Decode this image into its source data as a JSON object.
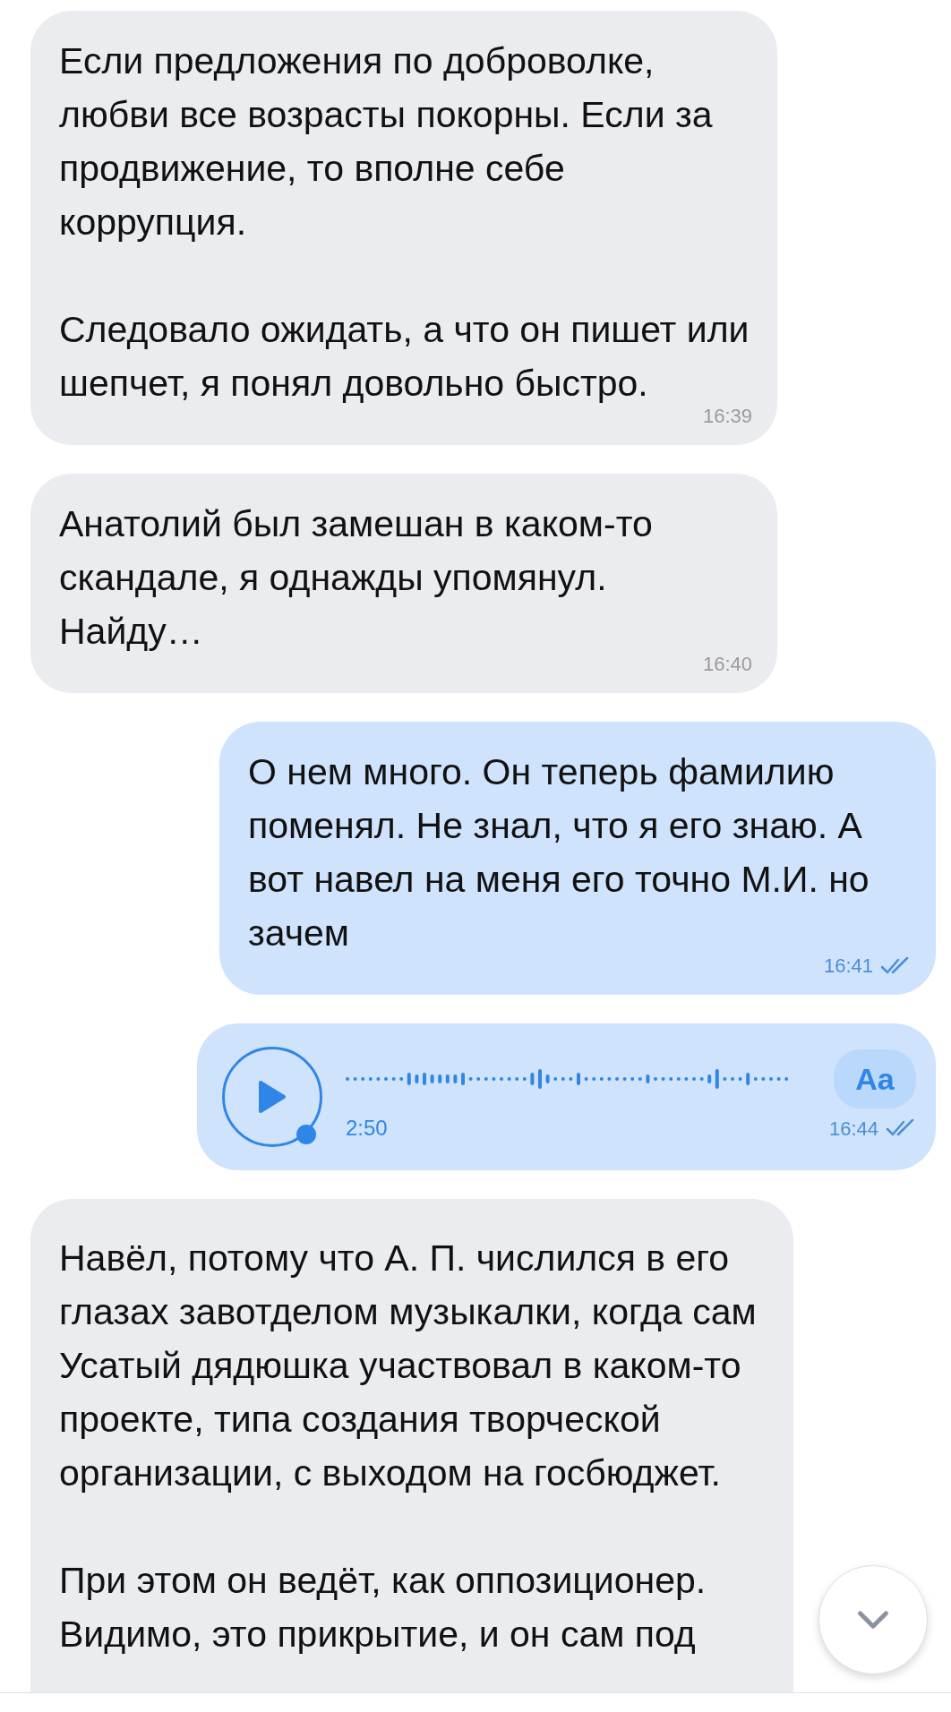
{
  "messages": [
    {
      "kind": "text",
      "outgoing": false,
      "text": "Если предложения по доброволке, любви все возрасты покорны. Если за продвижение, то вполне себе коррупция.\n\nСледовало ожидать, а что он пишет или шепчет, я понял довольно быстро.",
      "time": "16:39"
    },
    {
      "kind": "text",
      "outgoing": false,
      "text": "Анатолий был замешан в каком-то скандале, я однажды упомянул. Найду…",
      "time": "16:40"
    },
    {
      "kind": "text",
      "outgoing": true,
      "text": "О нем много. Он теперь фамилию поменял. Не знал, что я его знаю. А вот навел на меня его точно М.И. но зачем",
      "time": "16:41",
      "read": true
    },
    {
      "kind": "voice",
      "outgoing": true,
      "duration": "2:50",
      "transcribe_label": "Aa",
      "time": "16:44",
      "read": true
    },
    {
      "kind": "text",
      "outgoing": false,
      "text": "Навёл, потому что А. П. числился в его глазах завотделом музыкалки, когда сам Усатый дядюшка участвовал в каком-то проекте, типа создания творческой организации, с выходом на госбюджет.\n\nПри этом он ведёт, как оппозиционер. Видимо, это прикрытие, и он сам под"
    }
  ]
}
